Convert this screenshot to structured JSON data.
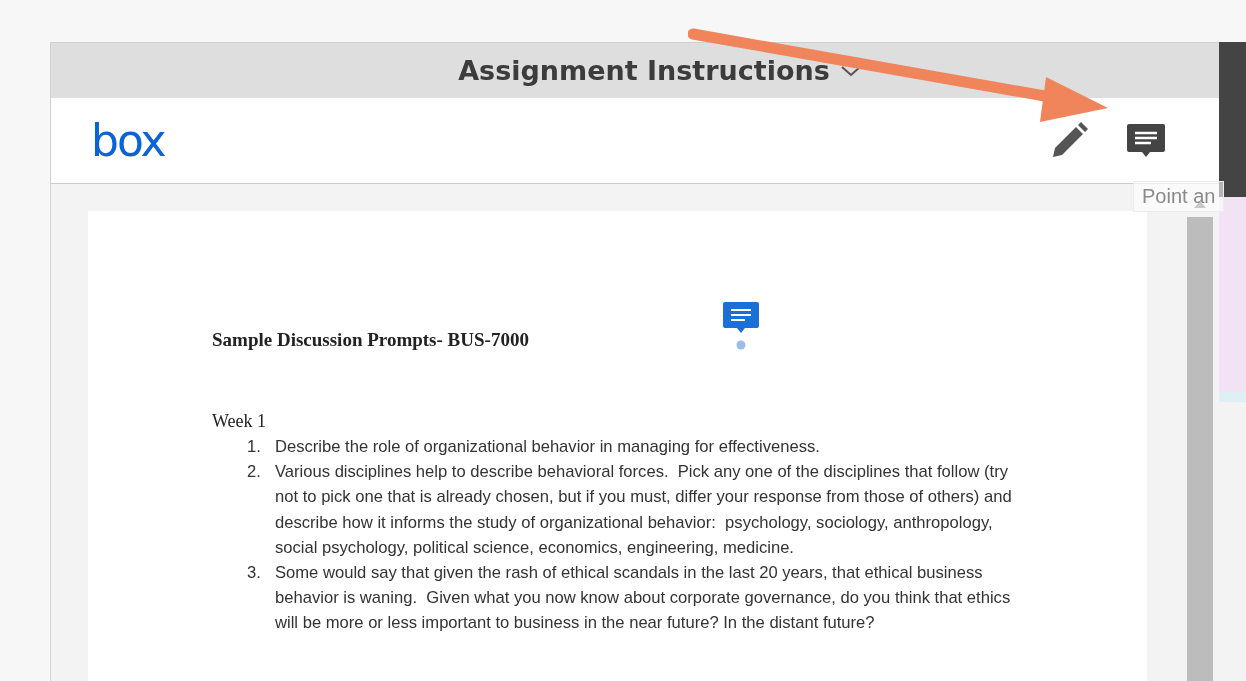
{
  "panel": {
    "title": "Assignment Instructions"
  },
  "toolbar": {
    "logo": "box",
    "tooltip": "Point an"
  },
  "document": {
    "heading": "Sample Discussion Prompts- BUS-7000",
    "section": "Week 1",
    "items": [
      {
        "number": "1.",
        "text": "Describe the role of organizational behavior in managing for effectiveness."
      },
      {
        "number": "2.",
        "text": "Various disciplines help to describe behavioral forces.  Pick any one of the disciplines that follow (try not to pick one that is already chosen, but if you must, differ your response from those of others) and describe how it informs the study of organizational behavior:  psychology, sociology, anthropology, social psychology, political science, economics, engineering, medicine."
      },
      {
        "number": "3.",
        "text": "Some would say that given the rash of ethical scandals in the last 20 years, that ethical business behavior is waning.  Given what you now know about corporate governance, do you think that ethics will be more or less important to business in the near future? In the distant future?"
      }
    ]
  }
}
